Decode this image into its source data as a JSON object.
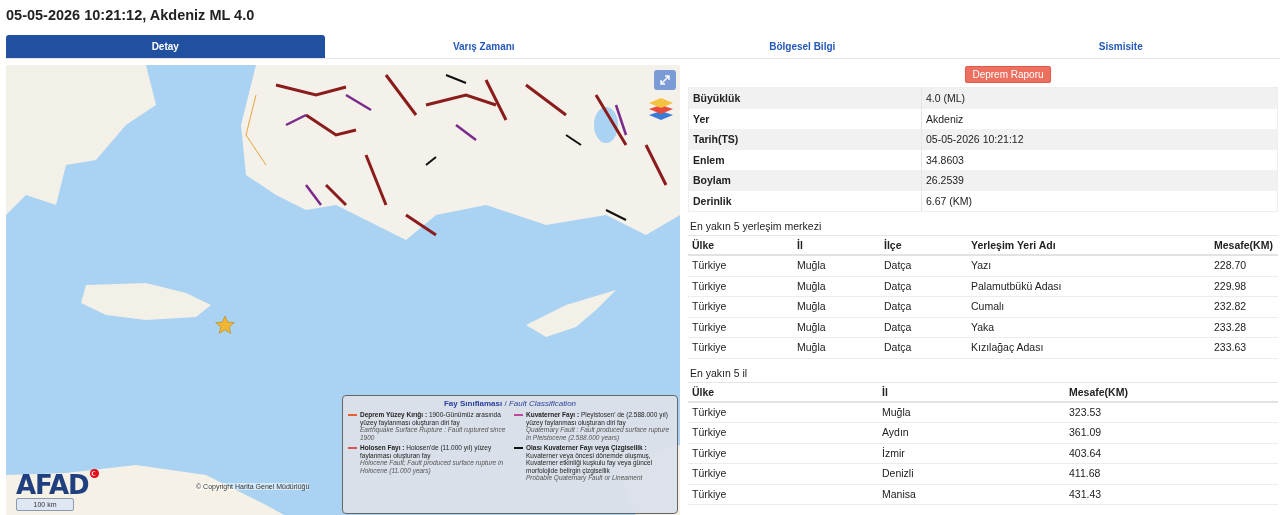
{
  "title": "05-05-2026 10:21:12, Akdeniz ML 4.0",
  "tabs": [
    {
      "label": "Detay",
      "selected": true
    },
    {
      "label": "Varış Zamanı",
      "selected": false
    },
    {
      "label": "Bölgesel Bilgi",
      "selected": false
    },
    {
      "label": "Sismisite",
      "selected": false
    }
  ],
  "map": {
    "legend": {
      "title": "**Fay Sınıflaması** / *Fault Classification*",
      "entries": [
        {
          "name": "Deprem Yüzey Kırığı :",
          "description": "1900-Günümüz arasında yüzey faylanması oluşturan diri fay",
          "english": "Earthquake Surface Rupture : Fault ruptured since 1900",
          "color": "#e8612c"
        },
        {
          "name": "Kuvaterner Fayı :",
          "description": "Pleyistosen' de (2.588.000 yıl) yüzey faylanması oluşturan diri fay",
          "english": "Quaternary Fault : Fault produced surface rupture in Pleistocene (2.588.000 years)",
          "color": "#c0479a"
        },
        {
          "name": "Holosen Fayı :",
          "description": "Holosen'de (11.000 yıl) yüzey faylanması oluşturan fay",
          "english": "Holocene Fault; Fault produced surface rupture in Holocene (11.000 years)",
          "color": "#d9534f"
        },
        {
          "name": "Olası Kuvaterner Fayı veya Çizgisellik :",
          "description": "Kuvaterner veya öncesi dönemde oluşmuş, Kuvaterner etkinliği kuşkulu fay veya güncel morfolojide belirgin çizgisellik",
          "english": "Probable Quaternary Fault or Lineament",
          "color": "#111111"
        }
      ]
    },
    "logo": "AFAD",
    "scale": "100 km",
    "copyright": "© Copyright Harita Genel Müdürlüğü"
  },
  "report_button": "Deprem Raporu",
  "details": [
    {
      "label": "Büyüklük",
      "value": "4.0 (ML)"
    },
    {
      "label": "Yer",
      "value": "Akdeniz"
    },
    {
      "label": "Tarih(TS)",
      "value": "05-05-2026 10:21:12"
    },
    {
      "label": "Enlem",
      "value": "34.8603"
    },
    {
      "label": "Boylam",
      "value": "26.2539"
    },
    {
      "label": "Derinlik",
      "value": "6.67 (KM)"
    }
  ],
  "settlements": {
    "title": "En yakın 5 yerleşim merkezi",
    "columns": [
      "Ülke",
      "İl",
      "İlçe",
      "Yerleşim Yeri Adı",
      "Mesafe(KM)"
    ],
    "rows": [
      [
        "Türkiye",
        "Muğla",
        "Datça",
        "Yazı",
        "228.70"
      ],
      [
        "Türkiye",
        "Muğla",
        "Datça",
        "Palamutbükü Adası",
        "229.98"
      ],
      [
        "Türkiye",
        "Muğla",
        "Datça",
        "Cumalı",
        "232.82"
      ],
      [
        "Türkiye",
        "Muğla",
        "Datça",
        "Yaka",
        "233.28"
      ],
      [
        "Türkiye",
        "Muğla",
        "Datça",
        "Kızılağaç Adası",
        "233.63"
      ]
    ]
  },
  "provinces": {
    "title": "En yakın 5 il",
    "columns": [
      "Ülke",
      "İl",
      "Mesafe(KM)"
    ],
    "rows": [
      [
        "Türkiye",
        "Muğla",
        "323.53"
      ],
      [
        "Türkiye",
        "Aydın",
        "361.09"
      ],
      [
        "Türkiye",
        "İzmir",
        "403.64"
      ],
      [
        "Türkiye",
        "Denizli",
        "411.68"
      ],
      [
        "Türkiye",
        "Manisa",
        "431.43"
      ]
    ]
  }
}
